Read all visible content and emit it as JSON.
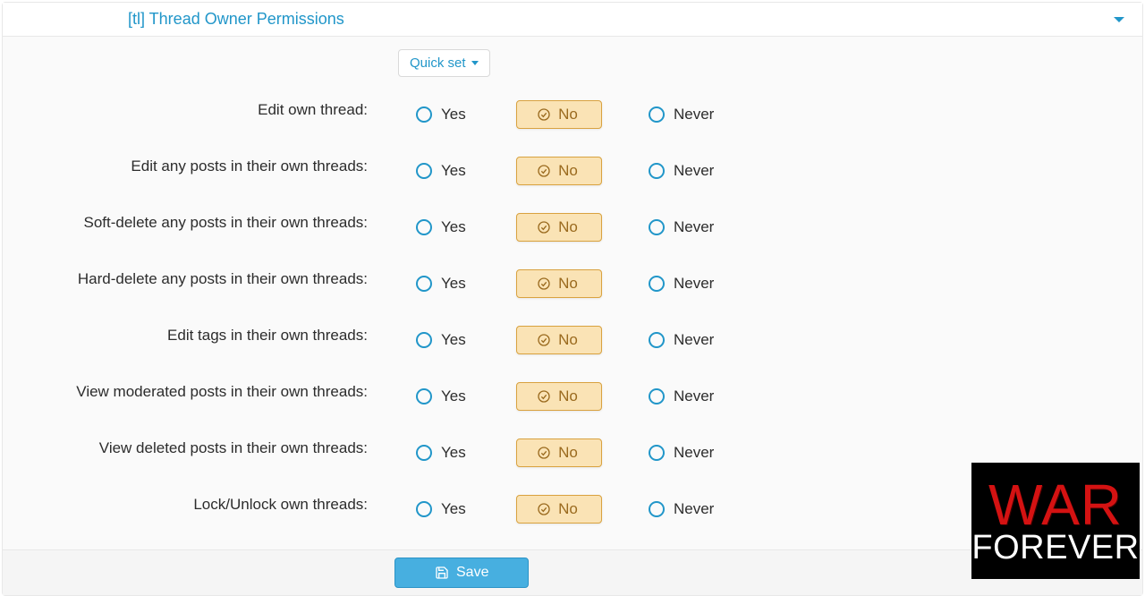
{
  "panel": {
    "title": "[tl] Thread Owner Permissions",
    "quickset_label": "Quick set"
  },
  "options": {
    "yes": "Yes",
    "no": "No",
    "never": "Never"
  },
  "permissions": [
    {
      "label": "Edit own thread:",
      "selected": "no"
    },
    {
      "label": "Edit any posts in their own threads:",
      "selected": "no"
    },
    {
      "label": "Soft-delete any posts in their own threads:",
      "selected": "no"
    },
    {
      "label": "Hard-delete any posts in their own threads:",
      "selected": "no"
    },
    {
      "label": "Edit tags in their own threads:",
      "selected": "no"
    },
    {
      "label": "View moderated posts in their own threads:",
      "selected": "no"
    },
    {
      "label": "View deleted posts in their own threads:",
      "selected": "no"
    },
    {
      "label": "Lock/Unlock own threads:",
      "selected": "no"
    }
  ],
  "footer": {
    "save_label": "Save"
  },
  "logo": {
    "line1": "WAR",
    "line2": "FOREVER"
  }
}
